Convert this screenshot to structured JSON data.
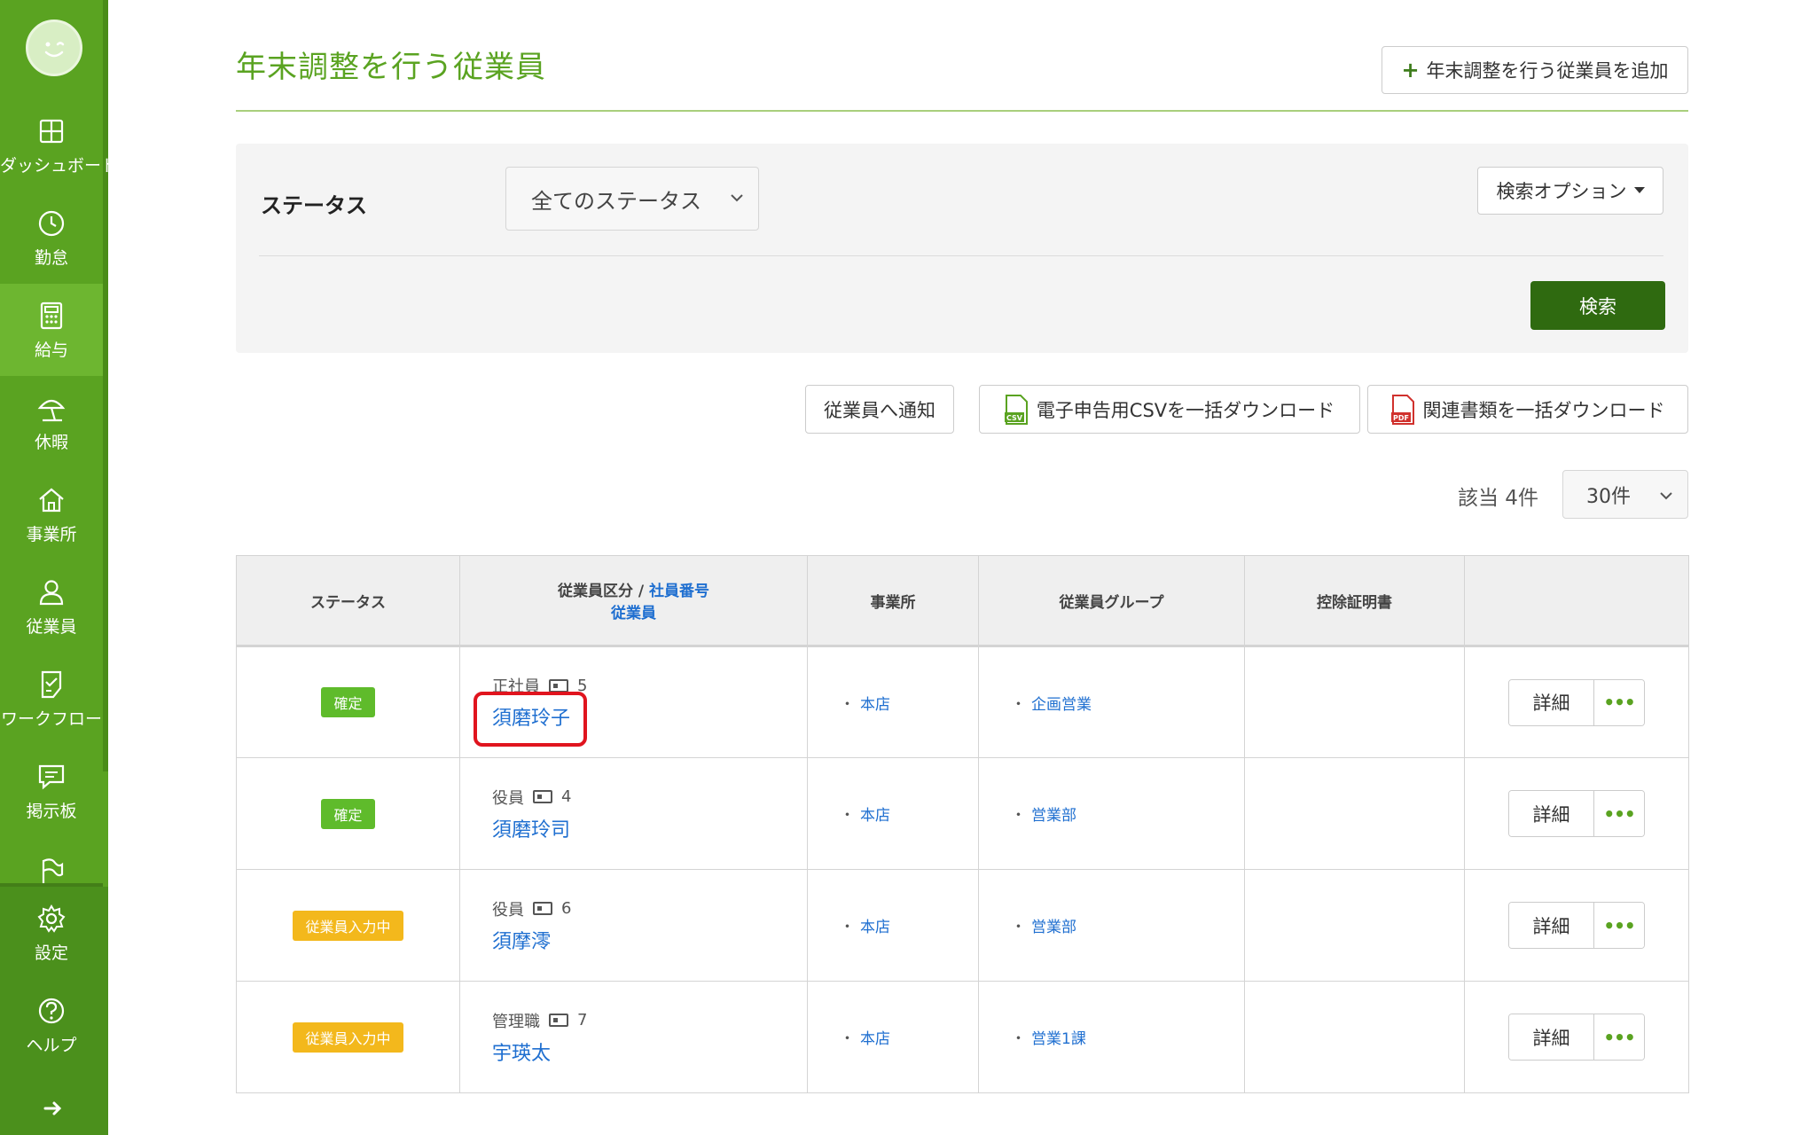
{
  "sidebar": {
    "items": [
      {
        "label": "ダッシュボード",
        "icon": "dashboard-icon"
      },
      {
        "label": "勤怠",
        "icon": "clock-icon"
      },
      {
        "label": "給与",
        "icon": "calculator-icon"
      },
      {
        "label": "休暇",
        "icon": "umbrella-icon"
      },
      {
        "label": "事業所",
        "icon": "home-icon"
      },
      {
        "label": "従業員",
        "icon": "person-icon"
      },
      {
        "label": "ワークフロー",
        "icon": "checklist-icon"
      },
      {
        "label": "掲示板",
        "icon": "message-icon"
      }
    ],
    "bottom_items": [
      {
        "label": "設定",
        "icon": "gear-icon"
      },
      {
        "label": "ヘルプ",
        "icon": "help-icon"
      }
    ],
    "active_item": "給与"
  },
  "header": {
    "title": "年末調整を行う従業員",
    "add_button": "年末調整を行う従業員を追加"
  },
  "search": {
    "status_label": "ステータス",
    "status_value": "全てのステータス",
    "options_button": "検索オプション",
    "search_button": "検索"
  },
  "actions": {
    "notify": "従業員へ通知",
    "csv_download": "電子申告用CSVを一括ダウンロード",
    "docs_download": "関連書類を一括ダウンロード",
    "csv_icon_text": "CSV",
    "pdf_icon_text": "PDF"
  },
  "result": {
    "count_text": "該当 4件",
    "per_page": "30件"
  },
  "table": {
    "headers": {
      "status": "ステータス",
      "category": "従業員区分",
      "separator": " / ",
      "number": "社員番号",
      "employee": "従業員",
      "office": "事業所",
      "group": "従業員グループ",
      "certificate": "控除証明書"
    },
    "rows": [
      {
        "status": "確定",
        "status_type": "done",
        "category": "正社員",
        "number": "5",
        "name": "須磨玲子",
        "office": "本店",
        "group": "企画営業",
        "detail": "詳細",
        "more": "•••"
      },
      {
        "status": "確定",
        "status_type": "done",
        "category": "役員",
        "number": "4",
        "name": "須磨玲司",
        "office": "本店",
        "group": "営業部",
        "detail": "詳細",
        "more": "•••"
      },
      {
        "status": "従業員入力中",
        "status_type": "input",
        "category": "役員",
        "number": "6",
        "name": "須摩澪",
        "office": "本店",
        "group": "営業部",
        "detail": "詳細",
        "more": "•••"
      },
      {
        "status": "従業員入力中",
        "status_type": "input",
        "category": "管理職",
        "number": "7",
        "name": "宇瑛太",
        "office": "本店",
        "group": "営業1課",
        "detail": "詳細",
        "more": "•••"
      }
    ]
  },
  "colors": {
    "brand_green": "#5aa321",
    "dark_green": "#2f6a10",
    "link_blue": "#1f6fd0",
    "badge_done": "#5fbb2b",
    "badge_input": "#f3b81c",
    "highlight_red": "#e0141e"
  }
}
